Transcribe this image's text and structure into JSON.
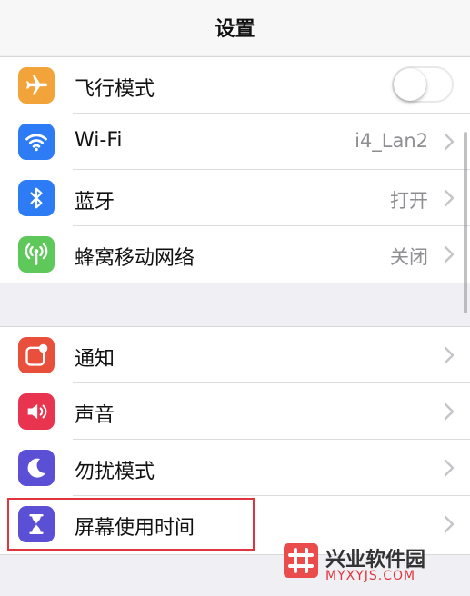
{
  "nav": {
    "title": "设置"
  },
  "colors": {
    "airplane": "#f2a33a",
    "wifi": "#2d7cf6",
    "bluetooth": "#2d7cf6",
    "cellular": "#5fc85a",
    "notifications": "#e9503b",
    "sounds": "#e8344f",
    "dnd": "#5b4fd6",
    "screentime": "#5b4fd6",
    "highlight": "#e0353c"
  },
  "group1": {
    "airplane": {
      "label": "飞行模式",
      "icon": "airplane-icon",
      "toggle_on": false
    },
    "wifi": {
      "label": "Wi-Fi",
      "value": "i4_Lan2",
      "icon": "wifi-icon"
    },
    "bluetooth": {
      "label": "蓝牙",
      "value": "打开",
      "icon": "bluetooth-icon"
    },
    "cellular": {
      "label": "蜂窝移动网络",
      "value": "关闭",
      "icon": "antenna-icon"
    }
  },
  "group2": {
    "notifications": {
      "label": "通知",
      "icon": "notification-badge-icon"
    },
    "sounds": {
      "label": "声音",
      "icon": "speaker-icon"
    },
    "dnd": {
      "label": "勿扰模式",
      "icon": "moon-icon"
    },
    "screentime": {
      "label": "屏幕使用时间",
      "icon": "hourglass-icon"
    }
  },
  "watermark": {
    "title": "兴业软件园",
    "subtitle": "MYXYJS.COM"
  }
}
